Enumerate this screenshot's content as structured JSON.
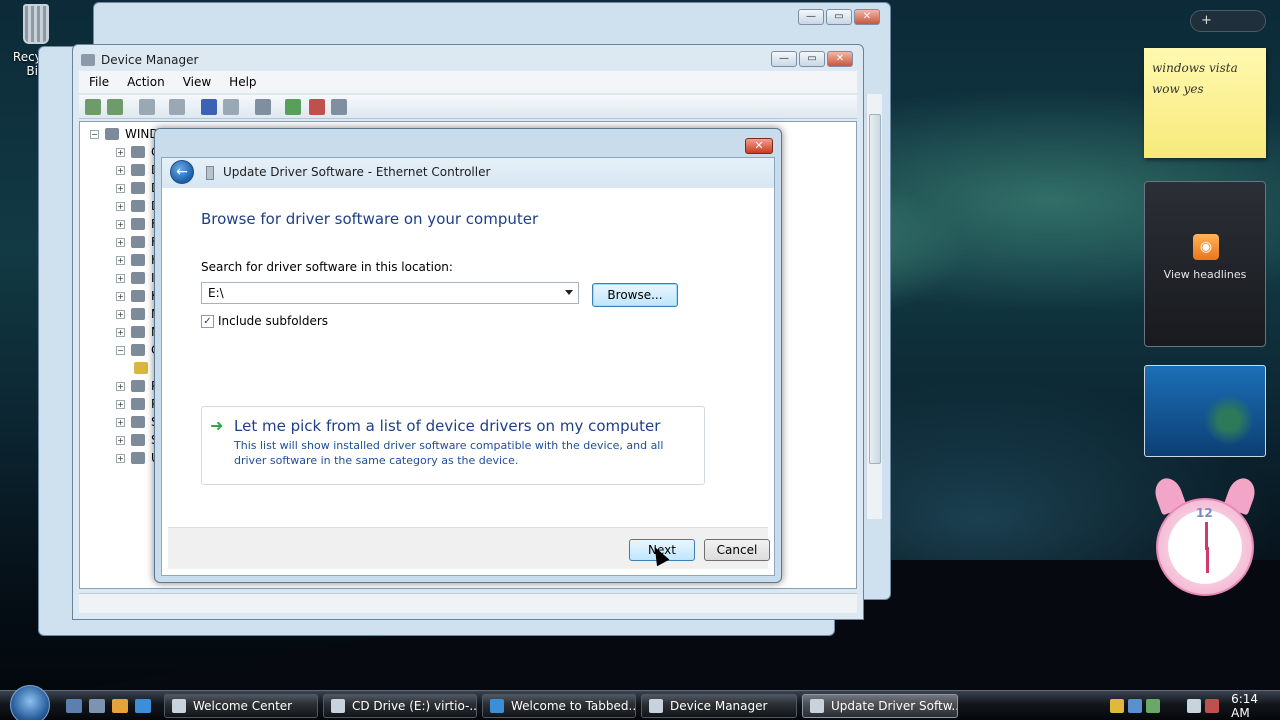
{
  "desktop": {
    "recycle_bin_label": "Recycle Bin"
  },
  "device_manager": {
    "title": "Device Manager",
    "menu": [
      "File",
      "Action",
      "View",
      "Help"
    ],
    "tree_root": "WIND",
    "tree_items": [
      "Co",
      "Di",
      "Di",
      "DV",
      "Fl",
      "Fl",
      "Hu",
      "ID",
      "Ke",
      "Mi",
      "Mo",
      "Ot",
      "",
      "Po",
      "Pr",
      "So",
      "Sy",
      "Un"
    ],
    "window_buttons": {
      "minimize": "—",
      "maximize": "▭",
      "close": "✕"
    }
  },
  "dialog": {
    "title": "Update Driver Software - Ethernet Controller",
    "close": "✕",
    "heading": "Browse for driver software on your computer",
    "location_label": "Search for driver software in this location:",
    "location_value": "E:\\",
    "browse_button": "Browse...",
    "include_subfolders_label": "Include subfolders",
    "include_subfolders_checked": true,
    "pick_title": "Let me pick from a list of device drivers on my computer",
    "pick_description": "This list will show installed driver software compatible with the device, and all driver software in the same category as the device.",
    "next_button": "Next",
    "cancel_button": "Cancel"
  },
  "sidebar": {
    "controls": "+",
    "note_text": "windows vista wow yes",
    "feed_label": "View headlines",
    "clock_twelve": "12"
  },
  "taskbar": {
    "tasks": [
      {
        "label": "Welcome Center",
        "active": false
      },
      {
        "label": "CD Drive (E:) virtio-...",
        "active": false
      },
      {
        "label": "Welcome to Tabbed...",
        "active": false
      },
      {
        "label": "Device Manager",
        "active": false
      },
      {
        "label": "Update Driver Softw...",
        "active": true
      }
    ],
    "time": "6:14 AM"
  },
  "colors": {
    "accent": "#1e3f88",
    "link_desc": "#1e4fa0",
    "check_green": "#2ea84a"
  }
}
